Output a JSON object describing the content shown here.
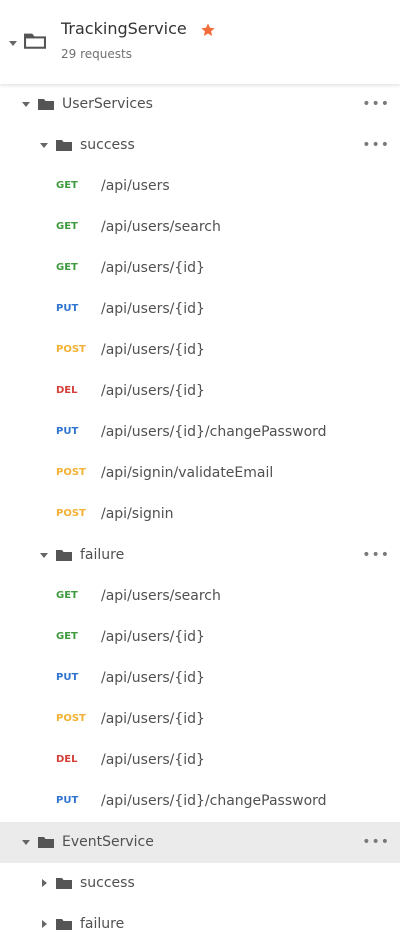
{
  "collection": {
    "name": "TrackingService",
    "subtitle": "29 requests"
  },
  "colors": {
    "GET": "#3f9a3f",
    "PUT": "#2f74d0",
    "POST": "#f2b134",
    "DEL": "#d43f3a",
    "star": "#f26b3a",
    "folder": "#555555"
  },
  "tree": [
    {
      "type": "folder",
      "level": 0,
      "expanded": true,
      "label": "UserServices",
      "menu": "•••",
      "selected": false
    },
    {
      "type": "folder",
      "level": 1,
      "expanded": true,
      "label": "success",
      "menu": "•••",
      "selected": false
    },
    {
      "type": "request",
      "method": "GET",
      "path": "/api/users"
    },
    {
      "type": "request",
      "method": "GET",
      "path": "/api/users/search"
    },
    {
      "type": "request",
      "method": "GET",
      "path": "/api/users/{id}"
    },
    {
      "type": "request",
      "method": "PUT",
      "path": "/api/users/{id}"
    },
    {
      "type": "request",
      "method": "POST",
      "path": "/api/users/{id}"
    },
    {
      "type": "request",
      "method": "DEL",
      "path": "/api/users/{id}"
    },
    {
      "type": "request",
      "method": "PUT",
      "path": "/api/users/{id}/changePassword"
    },
    {
      "type": "request",
      "method": "POST",
      "path": "/api/signin/validateEmail"
    },
    {
      "type": "request",
      "method": "POST",
      "path": "/api/signin"
    },
    {
      "type": "folder",
      "level": 1,
      "expanded": true,
      "label": "failure",
      "menu": "•••",
      "selected": false
    },
    {
      "type": "request",
      "method": "GET",
      "path": "/api/users/search"
    },
    {
      "type": "request",
      "method": "GET",
      "path": "/api/users/{id}"
    },
    {
      "type": "request",
      "method": "PUT",
      "path": "/api/users/{id}"
    },
    {
      "type": "request",
      "method": "POST",
      "path": "/api/users/{id}"
    },
    {
      "type": "request",
      "method": "DEL",
      "path": "/api/users/{id}"
    },
    {
      "type": "request",
      "method": "PUT",
      "path": "/api/users/{id}/changePassword"
    },
    {
      "type": "folder",
      "level": 0,
      "expanded": true,
      "label": "EventService",
      "menu": "•••",
      "selected": true
    },
    {
      "type": "folder",
      "level": 1,
      "expanded": false,
      "label": "success",
      "menu": "",
      "selected": false
    },
    {
      "type": "folder",
      "level": 1,
      "expanded": false,
      "label": "failure",
      "menu": "",
      "selected": false
    }
  ]
}
